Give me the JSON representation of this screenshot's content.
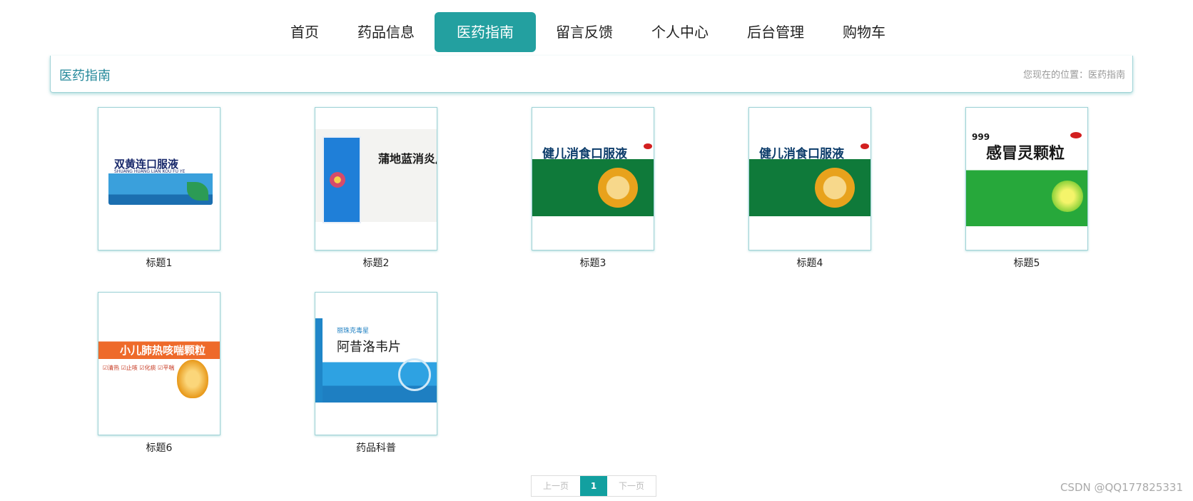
{
  "nav": {
    "items": [
      {
        "label": "首页",
        "active": false
      },
      {
        "label": "药品信息",
        "active": false
      },
      {
        "label": "医药指南",
        "active": true
      },
      {
        "label": "留言反馈",
        "active": false
      },
      {
        "label": "个人中心",
        "active": false
      },
      {
        "label": "后台管理",
        "active": false
      },
      {
        "label": "购物车",
        "active": false
      }
    ]
  },
  "breadcrumb": {
    "title": "医药指南",
    "location": "您现在的位置：医药指南"
  },
  "cards": [
    {
      "title": "标题1",
      "box_text": "双黄连口服液",
      "box_sub": "SHUANG HUANG LIAN KOU FU YE"
    },
    {
      "title": "标题2",
      "box_text": "蒲地蓝消炎片"
    },
    {
      "title": "标题3",
      "box_text": "健儿消食口服液"
    },
    {
      "title": "标题4",
      "box_text": "健儿消食口服液"
    },
    {
      "title": "标题5",
      "box_text": "感冒灵颗粒",
      "box_brand": "999"
    },
    {
      "title": "标题6",
      "box_text": "小儿肺热咳喘颗粒",
      "box_sub": "☑清热 ☑止咳 ☑化痰 ☑平喘"
    },
    {
      "title": "药品科普",
      "box_text": "阿昔洛韦片",
      "box_sub": "丽珠克毒星"
    }
  ],
  "pager": {
    "prev": "上一页",
    "current": "1",
    "next": "下一页"
  },
  "watermark": "CSDN @QQ177825331",
  "colors": {
    "accent": "#23a0a0",
    "border": "#9fd2d6"
  }
}
